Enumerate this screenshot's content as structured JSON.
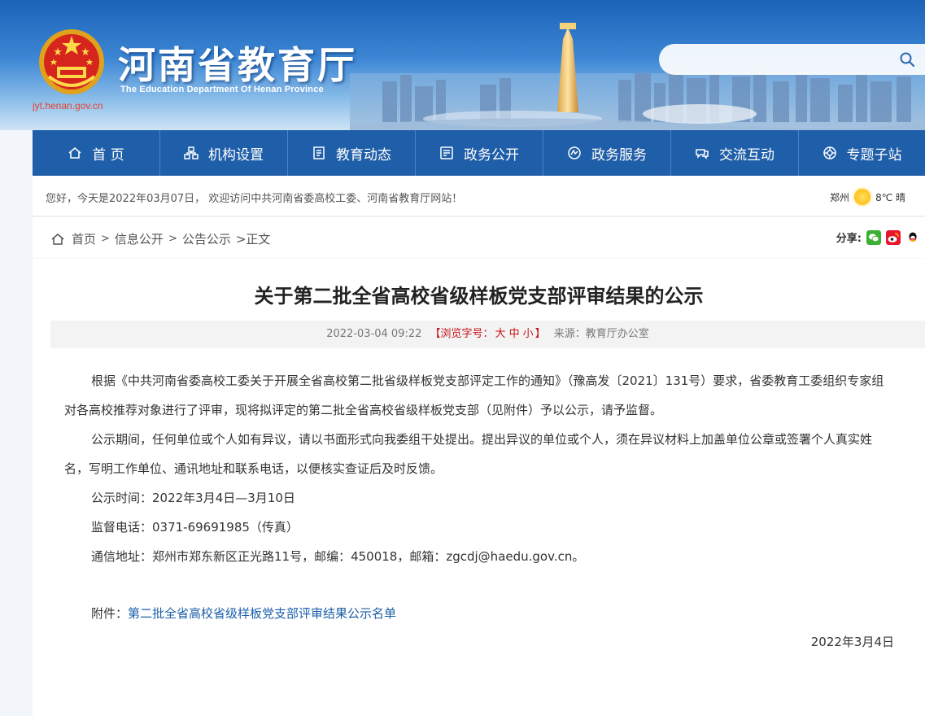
{
  "header": {
    "site_title": "河南省教育厅",
    "site_subtitle": "The Education Department Of Henan Province",
    "site_url": "jyt.henan.gov.cn",
    "search_placeholder": ""
  },
  "nav": [
    {
      "label": "首 页",
      "icon": "home-icon"
    },
    {
      "label": "机构设置",
      "icon": "org-icon"
    },
    {
      "label": "教育动态",
      "icon": "news-icon"
    },
    {
      "label": "政务公开",
      "icon": "public-icon"
    },
    {
      "label": "政务服务",
      "icon": "service-icon"
    },
    {
      "label": "交流互动",
      "icon": "interaction-icon"
    },
    {
      "label": "专题子站",
      "icon": "subsite-icon"
    }
  ],
  "greeting": {
    "text": "您好，今天是2022年03月07日， 欢迎访问中共河南省委高校工委、河南省教育厅网站！",
    "city": "郑州",
    "weather": "8℃ 晴"
  },
  "breadcrumb": {
    "home": "首页",
    "sep": ">",
    "level1": "信息公开",
    "level2": "公告公示",
    "current": ">正文",
    "share_label": "分享:"
  },
  "article": {
    "title": "关于第二批全省高校省级样板党支部评审结果的公示",
    "meta_date": "2022-03-04 09:22",
    "meta_font_label_open": "【浏览字号：",
    "font_large": "大",
    "font_medium": "中",
    "font_small": "小",
    "meta_font_label_close": "】",
    "meta_source": "来源：教育厅办公室",
    "para1": "根据《中共河南省委高校工委关于开展全省高校第二批省级样板党支部评定工作的通知》（豫高发〔2021〕131号）要求，省委教育工委组织专家组对各高校推荐对象进行了评审，现将拟评定的第二批全省高校省级样板党支部（见附件）予以公示，请予监督。",
    "para2": "公示期间，任何单位或个人如有异议，请以书面形式向我委组干处提出。提出异议的单位或个人，须在异议材料上加盖单位公章或签署个人真实姓名，写明工作单位、通讯地址和联系电话，以便核实查证后及时反馈。",
    "para3": "公示时间：2022年3月4日—3月10日",
    "para4": "监督电话：0371-69691985（传真）",
    "para5": "通信地址：郑州市郑东新区正光路11号，邮编：450018，邮箱：zgcdj@haedu.gov.cn。",
    "attach_label": "附件：",
    "attach_link": "第二批全省高校省级样板党支部评审结果公示名单",
    "sign_date": "2022年3月4日"
  },
  "colors": {
    "nav_bg": "#1f5ea8",
    "accent_red": "#c8131a",
    "link_blue": "#1b5fa9"
  }
}
